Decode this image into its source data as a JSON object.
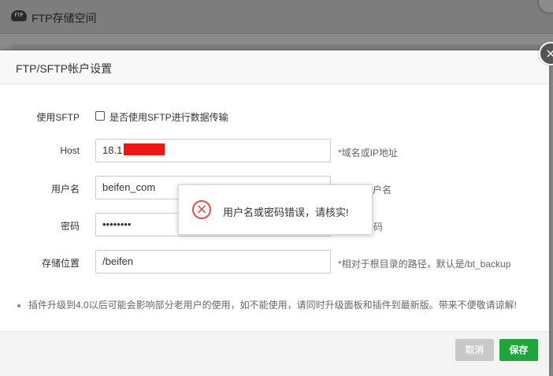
{
  "background": {
    "title": "FTP存储空间",
    "logo_text": "FTP"
  },
  "dialog": {
    "title": "FTP/SFTP帐户设置",
    "close_glyph": "×"
  },
  "form": {
    "sftp": {
      "label": "使用SFTP",
      "checkbox_label": "是否使用SFTP进行数据传输",
      "checked": false
    },
    "host": {
      "label": "Host",
      "value": "18.1",
      "hint": "*域名或IP地址"
    },
    "username": {
      "label": "用户名",
      "value": "beifen_com",
      "hint": "户名"
    },
    "password": {
      "label": "密码",
      "value": "••••••••",
      "hint": "码"
    },
    "storage": {
      "label": "存储位置",
      "value": "/beifen",
      "hint": "*相对于根目录的路径，默认是/bt_backup"
    }
  },
  "note": "插件升级到4.0以后可能会影响部分老用户的使用，如不能使用，请同时升级面板和插件到最新版。带来不便敬请谅解!",
  "buttons": {
    "cancel": "取消",
    "save": "保存"
  },
  "toast": {
    "icon": "error-circle-icon",
    "message": "用户名或密码错误，请核实!"
  },
  "colors": {
    "save_green": "#20a53a",
    "error_red": "#e8493c",
    "redaction": "#f01414"
  }
}
